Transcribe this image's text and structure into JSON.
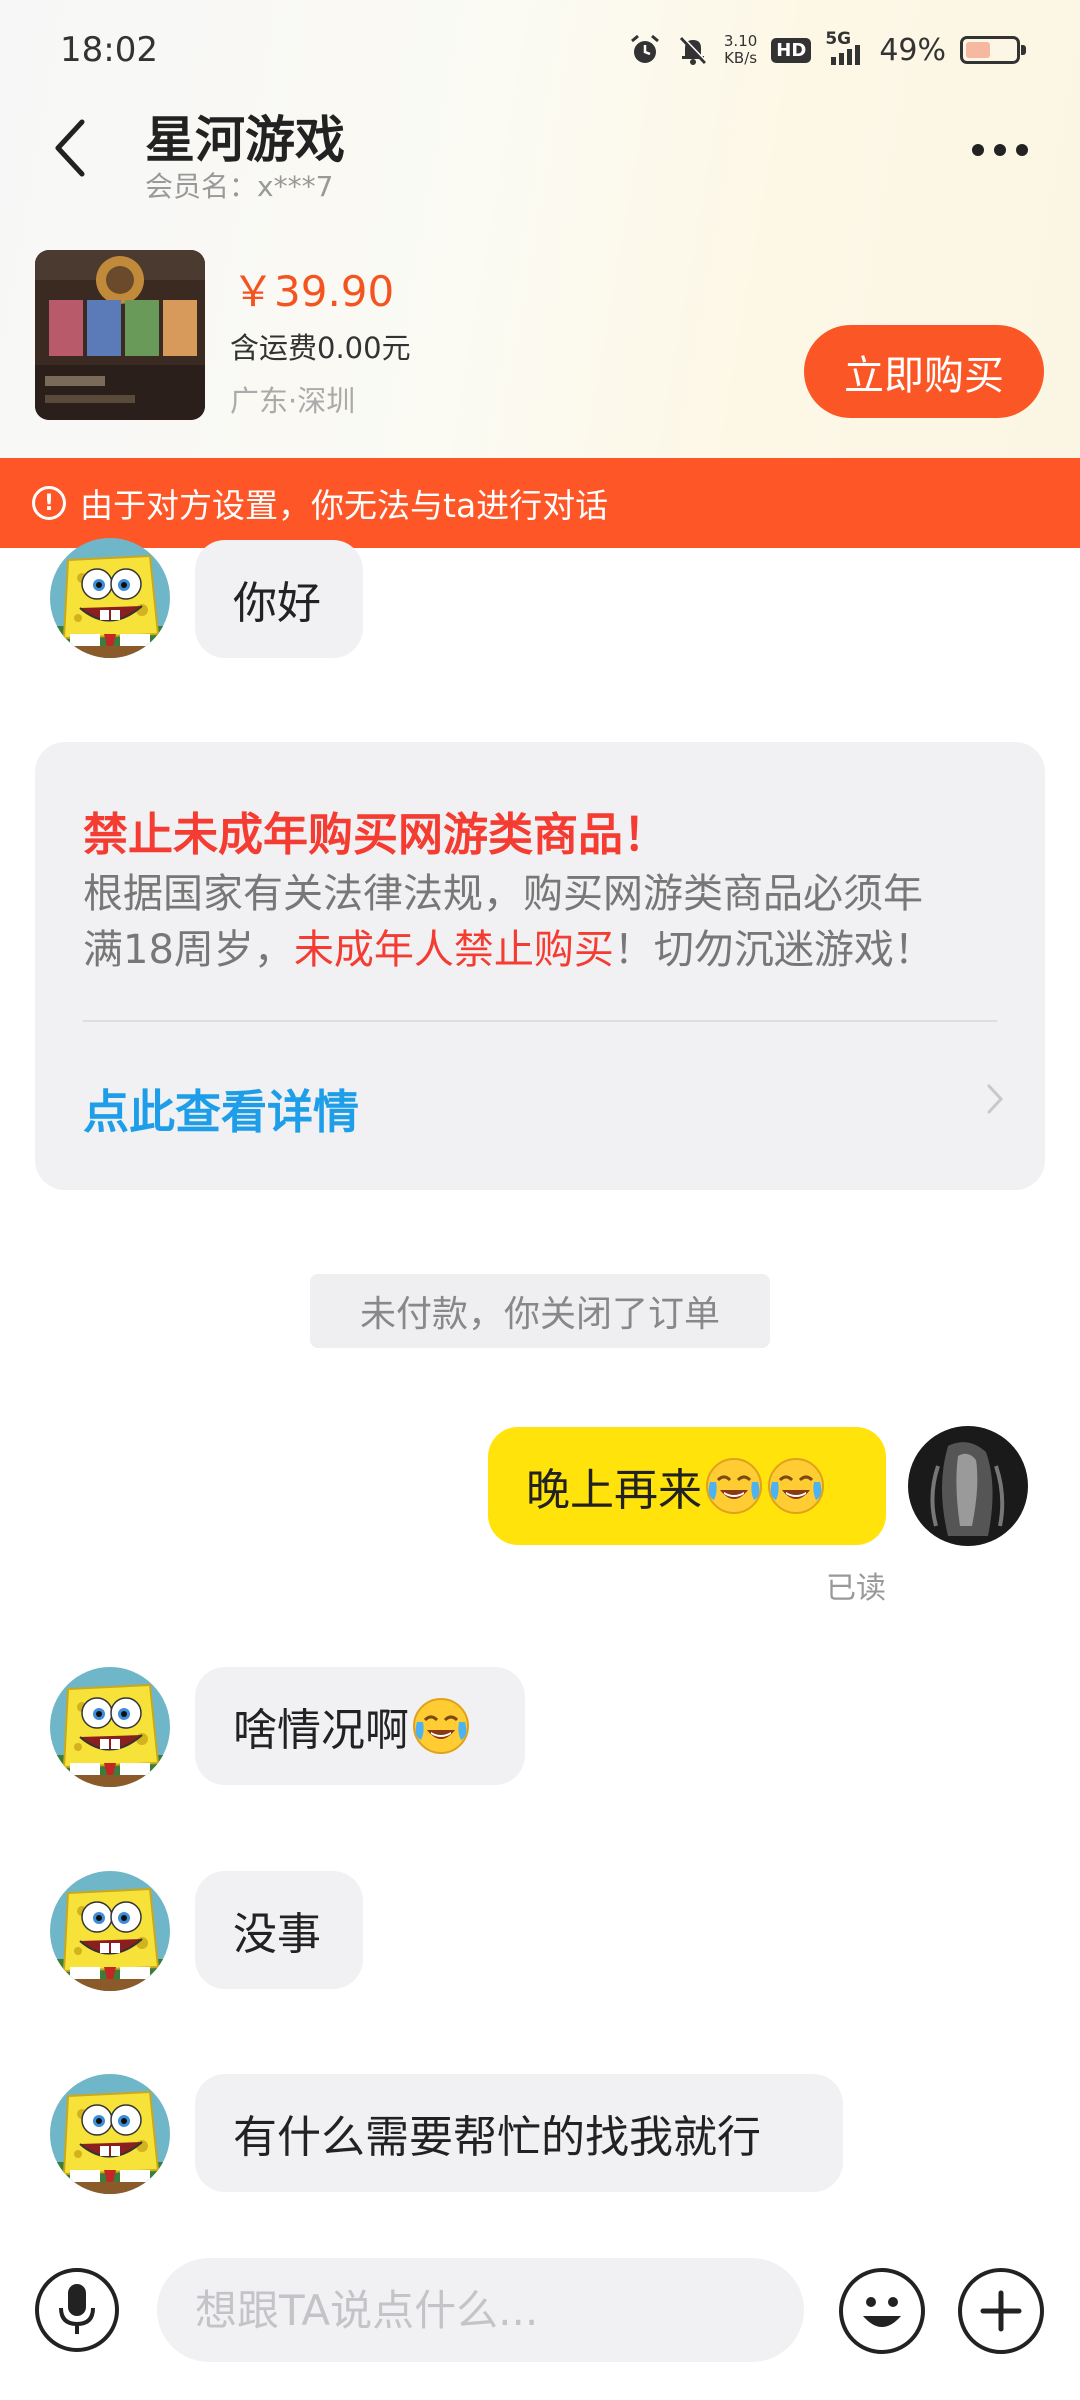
{
  "status_bar": {
    "time": "18:02",
    "net_speed_value": "3.10",
    "net_speed_unit": "KB/s",
    "hd_label": "HD",
    "network": "5G",
    "battery_percent": "49%",
    "battery_level": 0.49
  },
  "header": {
    "title": "星河游戏",
    "member_label": "会员名：x***7"
  },
  "product": {
    "price": "￥39.90",
    "shipping": "含运费0.00元",
    "location": "广东·深圳",
    "buy_label": "立即购买"
  },
  "banner": {
    "icon": "alert-circle-icon",
    "text": "由于对方设置，你无法与ta进行对话"
  },
  "notice_card": {
    "title": "禁止未成年购买网游类商品！",
    "body_line1": "根据国家有关法律法规，购买网游类商品必须年",
    "body_line2_prefix": "满18周岁，",
    "body_line2_red": "未成年人禁止购买",
    "body_line2_suffix": "！切勿沉迷游戏！",
    "link": "点此查看详情"
  },
  "messages": [
    {
      "from": "seller",
      "text": "你好"
    },
    {
      "from": "me",
      "text": "晚上再来",
      "emoji": [
        "crying-laughing-emoji",
        "crying-laughing-emoji"
      ],
      "status": "已读"
    },
    {
      "from": "seller",
      "text": "啥情况啊",
      "emoji": [
        "crying-laughing-emoji"
      ]
    },
    {
      "from": "seller",
      "text": "没事"
    },
    {
      "from": "seller",
      "text": "有什么需要帮忙的找我就行"
    }
  ],
  "system_message": "未付款，你关闭了订单",
  "input_bar": {
    "placeholder": "想跟TA说点什么..."
  },
  "colors": {
    "accent": "#fb5726",
    "banner": "#fe5627",
    "price": "#f4541f",
    "my_bubble": "#ffe30a",
    "link": "#1e9ee8",
    "warning_red": "#f43c32"
  }
}
